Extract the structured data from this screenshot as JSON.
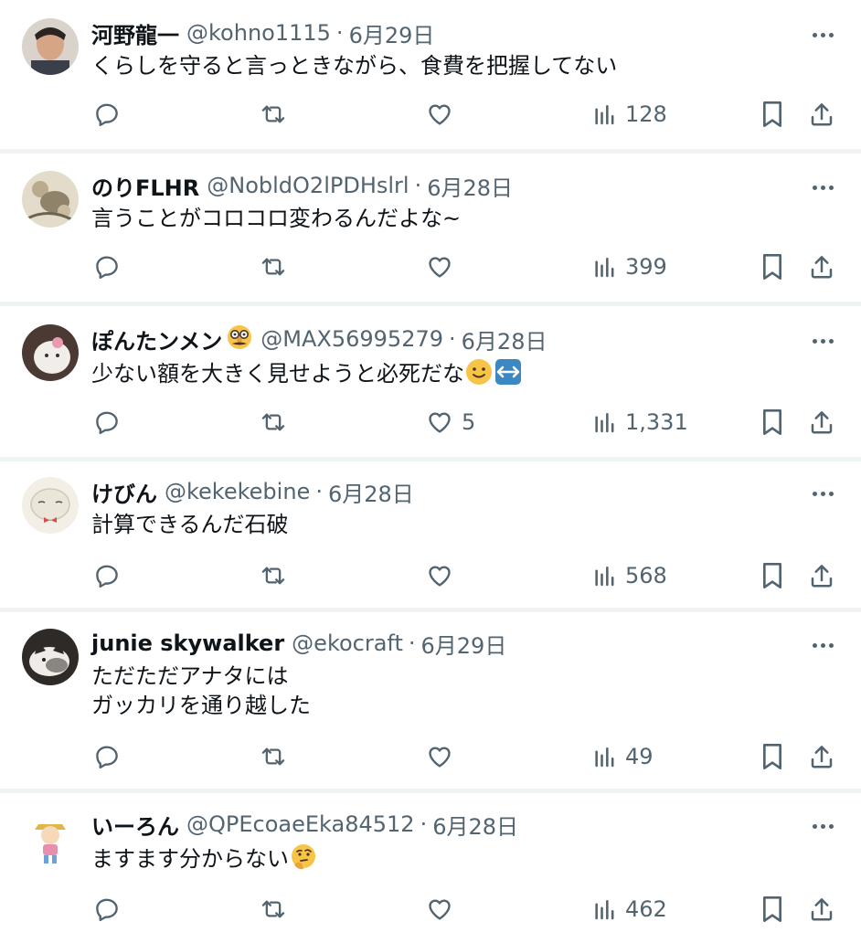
{
  "colors": {
    "text": "#0f1419",
    "secondary": "#536471",
    "divider": "#eff3f4"
  },
  "icons": [
    "reply-icon",
    "retweet-icon",
    "like-icon",
    "views-icon",
    "bookmark-icon",
    "share-icon",
    "more-icon"
  ],
  "replies": [
    {
      "name": "河野龍一",
      "handle": "@kohno1115",
      "sep": "·",
      "date": "6月29日",
      "text_lines": [
        "くらしを守ると言っときながら、食費を把握してない"
      ],
      "likes": "",
      "views": "128"
    },
    {
      "name": "のりFLHR",
      "handle": "@NobldO2lPDHslrl",
      "sep": "·",
      "date": "6月28日",
      "text_lines": [
        "言うことがコロコロ変わるんだよな~"
      ],
      "likes": "",
      "views": "399"
    },
    {
      "name": "ぽんたンメン",
      "badge": "disguise-face-emoji",
      "handle": "@MAX56995279",
      "sep": "·",
      "date": "6月28日",
      "text_lines": [
        "少ない額を大きく見せようと必死だな"
      ],
      "emojis": [
        "slightly-smiling-face-emoji",
        "left-right-arrow-emoji"
      ],
      "likes": "5",
      "views": "1,331"
    },
    {
      "name": "けびん",
      "handle": "@kekekebine",
      "sep": "·",
      "date": "6月28日",
      "text_lines": [
        "計算できるんだ石破"
      ],
      "likes": "",
      "views": "568"
    },
    {
      "name": "junie skywalker",
      "handle": "@ekocraft",
      "sep": "·",
      "date": "6月29日",
      "text_lines": [
        "ただただアナタには",
        "ガッカリを通り越した"
      ],
      "likes": "",
      "views": "49"
    },
    {
      "name": "いーろん",
      "handle": "@QPEcoaeEka84512",
      "sep": "·",
      "date": "6月28日",
      "text_lines": [
        "ますます分からない"
      ],
      "emojis": [
        "thinking-face-emoji"
      ],
      "likes": "",
      "views": "462"
    }
  ]
}
